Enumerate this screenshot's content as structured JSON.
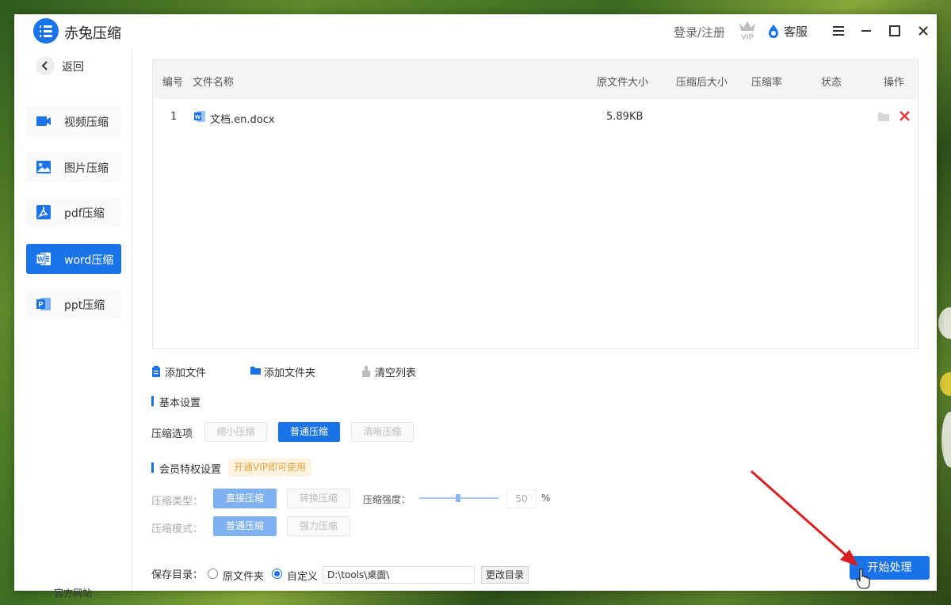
{
  "app": {
    "title": "赤兔压缩"
  },
  "titlebar": {
    "login_label": "登录/注册",
    "vip_label": "VIP",
    "service_label": "客服"
  },
  "sidebar": {
    "back_label": "返回",
    "items": [
      {
        "label": "视频压缩",
        "icon": "video-icon",
        "active": false
      },
      {
        "label": "图片压缩",
        "icon": "image-icon",
        "active": false
      },
      {
        "label": "pdf压缩",
        "icon": "pdf-icon",
        "active": false
      },
      {
        "label": "word压缩",
        "icon": "word-icon",
        "active": true
      },
      {
        "label": "ppt压缩",
        "icon": "ppt-icon",
        "active": false
      }
    ],
    "official_site": "官方网站"
  },
  "table": {
    "headers": {
      "num": "编号",
      "name": "文件名称",
      "orig_size": "原文件大小",
      "new_size": "压缩后大小",
      "ratio": "压缩率",
      "status": "状态",
      "action": "操作"
    },
    "rows": [
      {
        "num": "1",
        "name": "文档.en.docx",
        "orig_size": "5.89KB",
        "new_size": "",
        "ratio": "",
        "status": ""
      }
    ]
  },
  "toolbar": {
    "add_file": "添加文件",
    "add_folder": "添加文件夹",
    "clear_list": "清空列表"
  },
  "basic_settings": {
    "title": "基本设置",
    "option_label": "压缩选项",
    "options": [
      "缩小压缩",
      "普通压缩",
      "清晰压缩"
    ],
    "selected": "普通压缩"
  },
  "vip_settings": {
    "title": "会员特权设置",
    "tag": "开通VIP即可使用",
    "type_label": "压缩类型：",
    "type_options": [
      "直接压缩",
      "转换压缩"
    ],
    "type_selected": "直接压缩",
    "strength_label": "压缩强度：",
    "strength_value": "50",
    "strength_unit": "%",
    "mode_label": "压缩模式：",
    "mode_options": [
      "普通压缩",
      "强力压缩"
    ],
    "mode_selected": "普通压缩"
  },
  "save": {
    "label": "保存目录：",
    "option_original": "原文件夹",
    "option_custom": "自定义",
    "selected": "自定义",
    "path": "D:\\tools\\桌面\\",
    "change_button": "更改目录"
  },
  "start_button": "开始处理",
  "colors": {
    "accent": "#1a73e8",
    "delete": "#e53935",
    "annotation_arrow": "#d71f1f",
    "vip_tag_bg": "#fdf3e1",
    "vip_tag_text": "#e6a23c"
  }
}
